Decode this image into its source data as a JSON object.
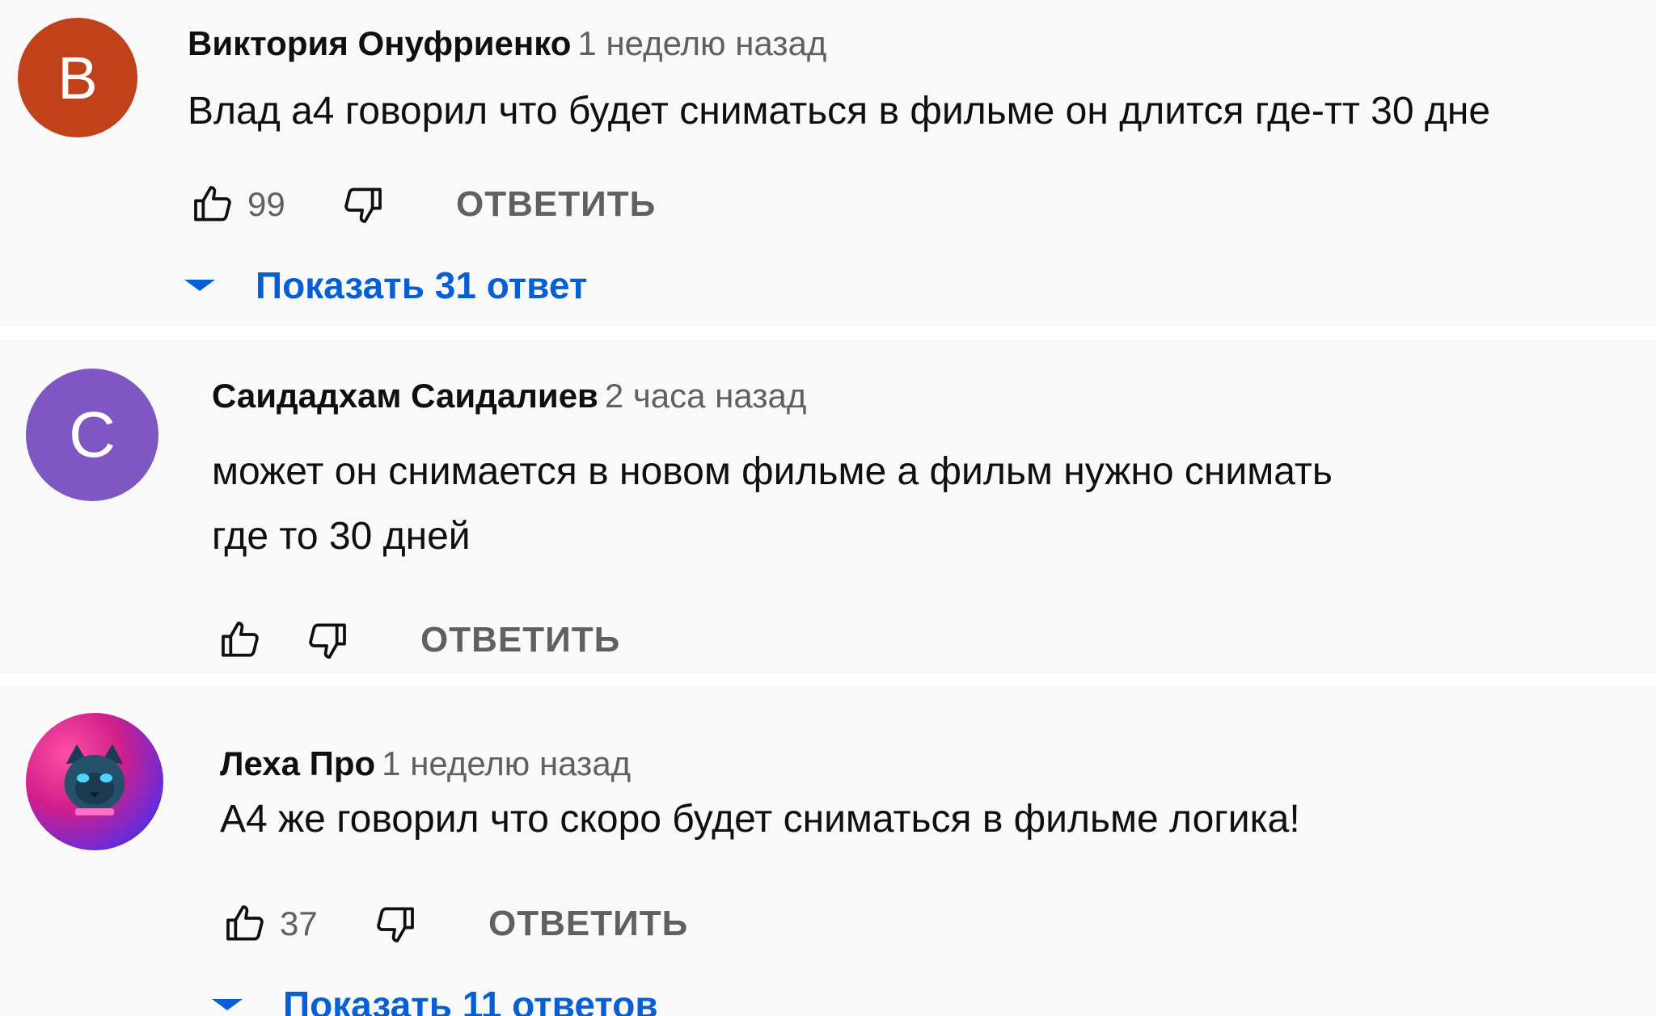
{
  "comments": [
    {
      "avatar_letter": "В",
      "avatar_color": "#c1411b",
      "author": "Виктория Онуфриенко",
      "time": "1 неделю назад",
      "text_lines": [
        "Влад а4 говорил что будет сниматься в фильме он длится где-тт 30 дне"
      ],
      "likes": "99",
      "reply_label": "ОТВЕТИТЬ",
      "show_replies": "Показать 31 ответ"
    },
    {
      "avatar_letter": "С",
      "avatar_color": "#7e57c2",
      "author": "Саидадхам Саидалиев",
      "time": "2 часа назад",
      "text_lines": [
        "может он снимается в новом фильме а фильм нужно снимать",
        "где то 30 дней"
      ],
      "likes": "",
      "reply_label": "ОТВЕТИТЬ"
    },
    {
      "avatar_icon": "cat-icon",
      "author": "Леха Про",
      "time": "1 неделю назад",
      "text_lines": [
        "А4 же говорил что скоро будет  сниматься в фильме логика!"
      ],
      "likes": "37",
      "reply_label": "ОТВЕТИТЬ",
      "show_replies": "Показать 11 ответов"
    }
  ],
  "icons": {
    "like": "thumb-up-icon",
    "dislike": "thumb-down-icon",
    "expand": "caret-down-icon"
  },
  "colors": {
    "link": "#065fd4",
    "secondary_text": "#606060",
    "primary_text": "#0f0f0f",
    "background": "#f9f9f9"
  }
}
